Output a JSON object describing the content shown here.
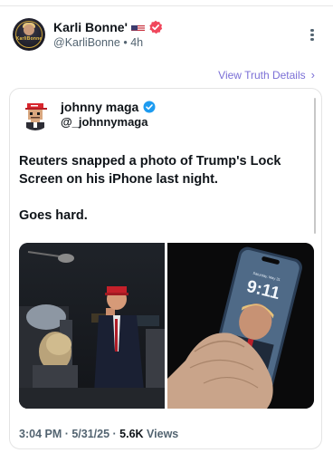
{
  "post": {
    "author_name": "Karli Bonne'",
    "author_flag": "flag-us-icon",
    "author_handle": "@KarliBonne",
    "separator": "•",
    "time": "4h",
    "avatar_text": "KarliBonne"
  },
  "view_details": {
    "label": "View Truth Details",
    "chevron": "›"
  },
  "embedded": {
    "author_name": "johnny maga",
    "author_handle": "@_johnnymaga",
    "text_line1": "Reuters snapped a photo of Trump's Lock Screen on his iPhone last night.",
    "text_line2": "Goes hard.",
    "photos": [
      {
        "name": "photo-trump-crowd"
      },
      {
        "name": "photo-iphone-lock-screen",
        "clock": "9:11"
      }
    ],
    "timestamp": "3:04 PM · 5/31/25 · ",
    "views_count": "5.6K",
    "views_label": " Views"
  },
  "colors": {
    "accent_purple": "#7b6fd6",
    "verified_pink": "#f0475c",
    "verified_blue": "#1d9bf0",
    "muted": "#536471"
  }
}
